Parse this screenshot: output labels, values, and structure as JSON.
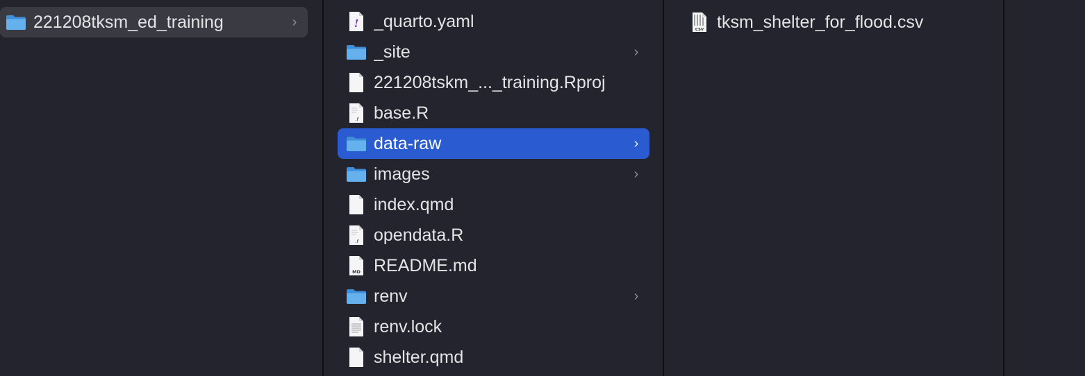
{
  "column1": {
    "items": [
      {
        "label": "221208tksm_ed_training",
        "icon": "folder-icon",
        "has_children": true
      }
    ]
  },
  "column2": {
    "items": [
      {
        "label": "_quarto.yaml",
        "icon": "yaml-file-icon",
        "has_children": false
      },
      {
        "label": "_site",
        "icon": "folder-icon",
        "has_children": true
      },
      {
        "label": "221208tskm_..._training.Rproj",
        "icon": "document-icon",
        "has_children": false
      },
      {
        "label": "base.R",
        "icon": "r-file-icon",
        "has_children": false
      },
      {
        "label": "data-raw",
        "icon": "folder-icon",
        "has_children": true,
        "selected": true
      },
      {
        "label": "images",
        "icon": "folder-icon",
        "has_children": true
      },
      {
        "label": "index.qmd",
        "icon": "document-icon",
        "has_children": false
      },
      {
        "label": "opendata.R",
        "icon": "r-file-icon",
        "has_children": false
      },
      {
        "label": "README.md",
        "icon": "markdown-file-icon",
        "has_children": false
      },
      {
        "label": "renv",
        "icon": "folder-icon",
        "has_children": true
      },
      {
        "label": "renv.lock",
        "icon": "text-file-icon",
        "has_children": false
      },
      {
        "label": "shelter.qmd",
        "icon": "document-icon",
        "has_children": false
      }
    ]
  },
  "column3": {
    "items": [
      {
        "label": "tksm_shelter_for_flood.csv",
        "icon": "csv-file-icon",
        "has_children": false
      }
    ]
  },
  "icon_badges": {
    "r_file": ".r",
    "markdown_file": "MD",
    "csv_file": "CSV",
    "yaml_file": "!"
  },
  "chevron_glyph": "›",
  "colors": {
    "background": "#23242d",
    "selection_active": "#2a5bd0",
    "selection_inactive": "#3a3b42",
    "folder": "#5ea9e8",
    "text": "#e4e4e6"
  }
}
